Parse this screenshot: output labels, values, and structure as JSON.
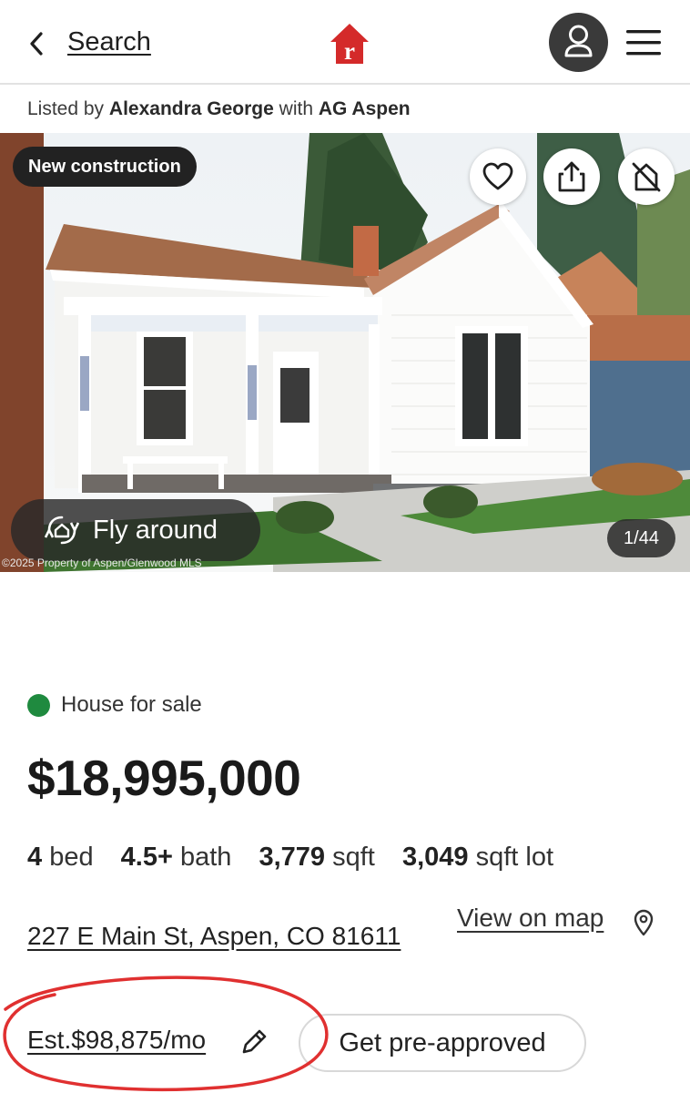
{
  "header": {
    "back_icon": "chevron-left-icon",
    "search_label": "Search",
    "logo_letter": "r",
    "brand_color": "#d42a2a"
  },
  "listing_agent": {
    "prefix": "Listed by",
    "agent_name": "Alexandra George",
    "connector": "with",
    "brokerage": "AG Aspen"
  },
  "photo": {
    "badge": "New construction",
    "fly_around_label": "Fly around",
    "copyright": "©2025 Property of Aspen/Glenwood MLS",
    "counter": "1/44",
    "actions": [
      "heart-icon",
      "share-icon",
      "hide-home-icon"
    ]
  },
  "details": {
    "status_label": "House for sale",
    "status_color": "#1f8a3f",
    "price": "$18,995,000",
    "beds_value": "4",
    "beds_unit": "bed",
    "baths_value": "4.5+",
    "baths_unit": "bath",
    "sqft_value": "3,779",
    "sqft_unit": "sqft",
    "lot_value": "3,049",
    "lot_unit": "sqft lot",
    "address": "227 E Main St, Aspen, CO 81611",
    "view_map_label": "View on map",
    "estimate": "Est.$98,875/mo",
    "preapproved_label": "Get pre-approved",
    "annotation_color": "#e03030"
  }
}
